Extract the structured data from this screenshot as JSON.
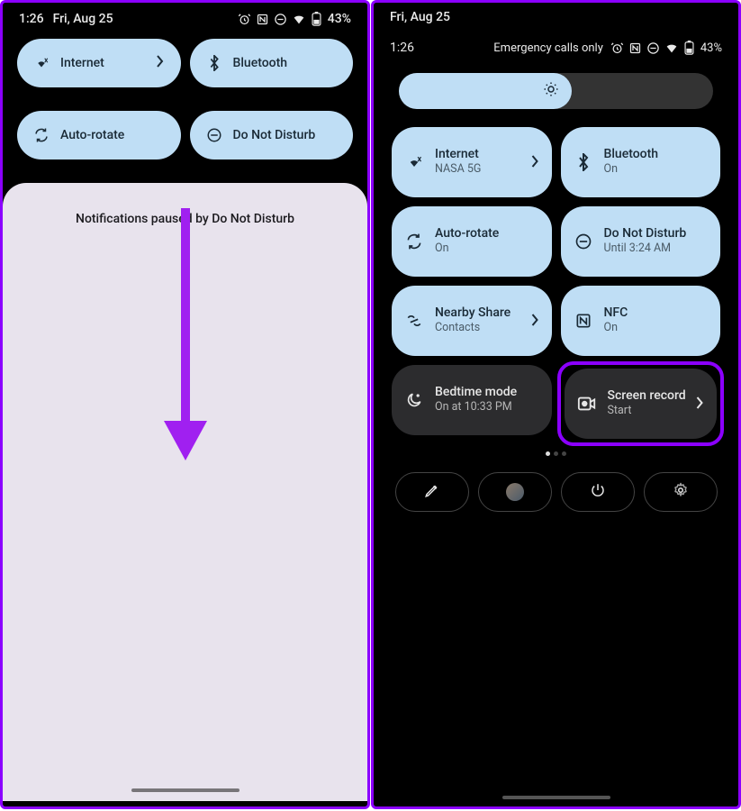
{
  "left": {
    "status": {
      "time": "1:26",
      "date": "Fri, Aug 25",
      "battery": "43%"
    },
    "tiles": [
      {
        "label": "Internet",
        "icon": "wifi",
        "hasChevron": true
      },
      {
        "label": "Bluetooth",
        "icon": "bluetooth",
        "hasChevron": false
      },
      {
        "label": "Auto-rotate",
        "icon": "rotate",
        "hasChevron": false
      },
      {
        "label": "Do Not Disturb",
        "icon": "dnd",
        "hasChevron": false
      }
    ],
    "notification_text": "Notifications paused by Do Not Disturb"
  },
  "right": {
    "header_date": "Fri, Aug 25",
    "status": {
      "time": "1:26",
      "network_text": "Emergency calls only",
      "battery": "43%"
    },
    "tiles": [
      {
        "title": "Internet",
        "sub": "NASA 5G",
        "icon": "wifi",
        "active": true,
        "chevron": true
      },
      {
        "title": "Bluetooth",
        "sub": "On",
        "icon": "bluetooth",
        "active": true,
        "chevron": false
      },
      {
        "title": "Auto-rotate",
        "sub": "On",
        "icon": "rotate",
        "active": true,
        "chevron": false
      },
      {
        "title": "Do Not Disturb",
        "sub": "Until 3:24 AM",
        "icon": "dnd",
        "active": true,
        "chevron": false
      },
      {
        "title": "Nearby Share",
        "sub": "Contacts",
        "icon": "nearby",
        "active": true,
        "chevron": true
      },
      {
        "title": "NFC",
        "sub": "On",
        "icon": "nfc",
        "active": true,
        "chevron": false
      },
      {
        "title": "Bedtime mode",
        "sub": "On at 10:33 PM",
        "icon": "bedtime",
        "active": false,
        "chevron": false
      },
      {
        "title": "Screen record",
        "sub": "Start",
        "icon": "record",
        "active": false,
        "chevron": true,
        "highlight": true
      }
    ],
    "page_count": 3,
    "active_page": 0
  }
}
